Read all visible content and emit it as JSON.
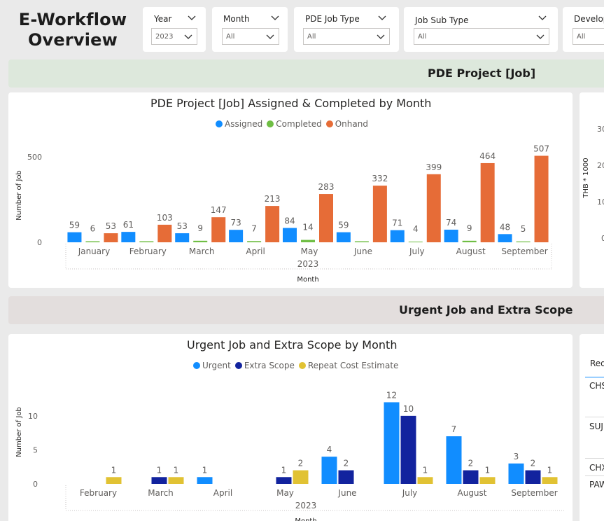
{
  "title": "E-Workflow Overview",
  "title_lines": [
    "E-Workflow",
    "Overview"
  ],
  "slicers": [
    {
      "label": "Year",
      "value": "2023"
    },
    {
      "label": "Month",
      "value": "All"
    },
    {
      "label": "PDE Job Type",
      "value": "All"
    },
    {
      "label": "Job Sub Type",
      "value": "All"
    },
    {
      "label": "Develop",
      "value": "All"
    }
  ],
  "banners": {
    "project": "PDE Project [Job]",
    "urgent": "Urgent Job and Extra Scope"
  },
  "colors": {
    "assigned": "#118dff",
    "completed": "#6fbe44",
    "onhand": "#e66c37",
    "urgent": "#118dff",
    "extra_scope": "#12239e",
    "repeat_cost": "#e1c233",
    "banner_green": "#dde8dc",
    "banner_grey": "#e3dedd"
  },
  "side_chart": {
    "ylabel": "THB * 1000",
    "ticks": [
      "30",
      "20",
      "10",
      "0"
    ]
  },
  "side_table": {
    "header": "Req",
    "rows": [
      "CHS",
      "SUJ",
      "CHX",
      "PAW"
    ]
  },
  "chart_data": [
    {
      "type": "bar",
      "title": "PDE Project [Job] Assigned & Completed by Month",
      "xlabel": "Month",
      "xsublabel": "2023",
      "ylabel": "Number of Job",
      "ylim": [
        0,
        550
      ],
      "yticks": [
        0,
        500
      ],
      "legend": "top-center",
      "categories": [
        "January",
        "February",
        "March",
        "April",
        "May",
        "June",
        "July",
        "August",
        "September"
      ],
      "series": [
        {
          "name": "Assigned",
          "values": [
            59,
            61,
            53,
            73,
            84,
            59,
            71,
            74,
            48
          ],
          "labels": [
            "59",
            "61",
            "53",
            "73",
            "84",
            "59",
            "71",
            "74",
            "48"
          ]
        },
        {
          "name": "Completed",
          "values": [
            6,
            6,
            9,
            7,
            14,
            6,
            4,
            9,
            5
          ],
          "labels": [
            "6",
            "",
            "9",
            "7",
            "14",
            "",
            "4",
            "9",
            "5"
          ]
        },
        {
          "name": "Onhand",
          "values": [
            53,
            103,
            147,
            213,
            283,
            332,
            399,
            464,
            507
          ],
          "labels": [
            "53",
            "103",
            "147",
            "213",
            "283",
            "332",
            "399",
            "464",
            "507"
          ]
        }
      ]
    },
    {
      "type": "bar",
      "title": "Urgent Job and Extra Scope by Month",
      "xlabel": "Month",
      "xsublabel": "2023",
      "ylabel": "Number of Job",
      "ylim": [
        0,
        14
      ],
      "yticks": [
        0,
        5,
        10
      ],
      "legend": "top-center",
      "categories": [
        "February",
        "March",
        "April",
        "May",
        "June",
        "July",
        "August",
        "September"
      ],
      "series": [
        {
          "name": "Urgent",
          "values": [
            0,
            0,
            1,
            0,
            4,
            12,
            7,
            3
          ]
        },
        {
          "name": "Extra Scope",
          "values": [
            0,
            1,
            0,
            1,
            2,
            10,
            2,
            2
          ]
        },
        {
          "name": "Repeat Cost Estimate",
          "values": [
            1,
            1,
            0,
            2,
            0,
            1,
            1,
            1
          ]
        }
      ]
    }
  ]
}
